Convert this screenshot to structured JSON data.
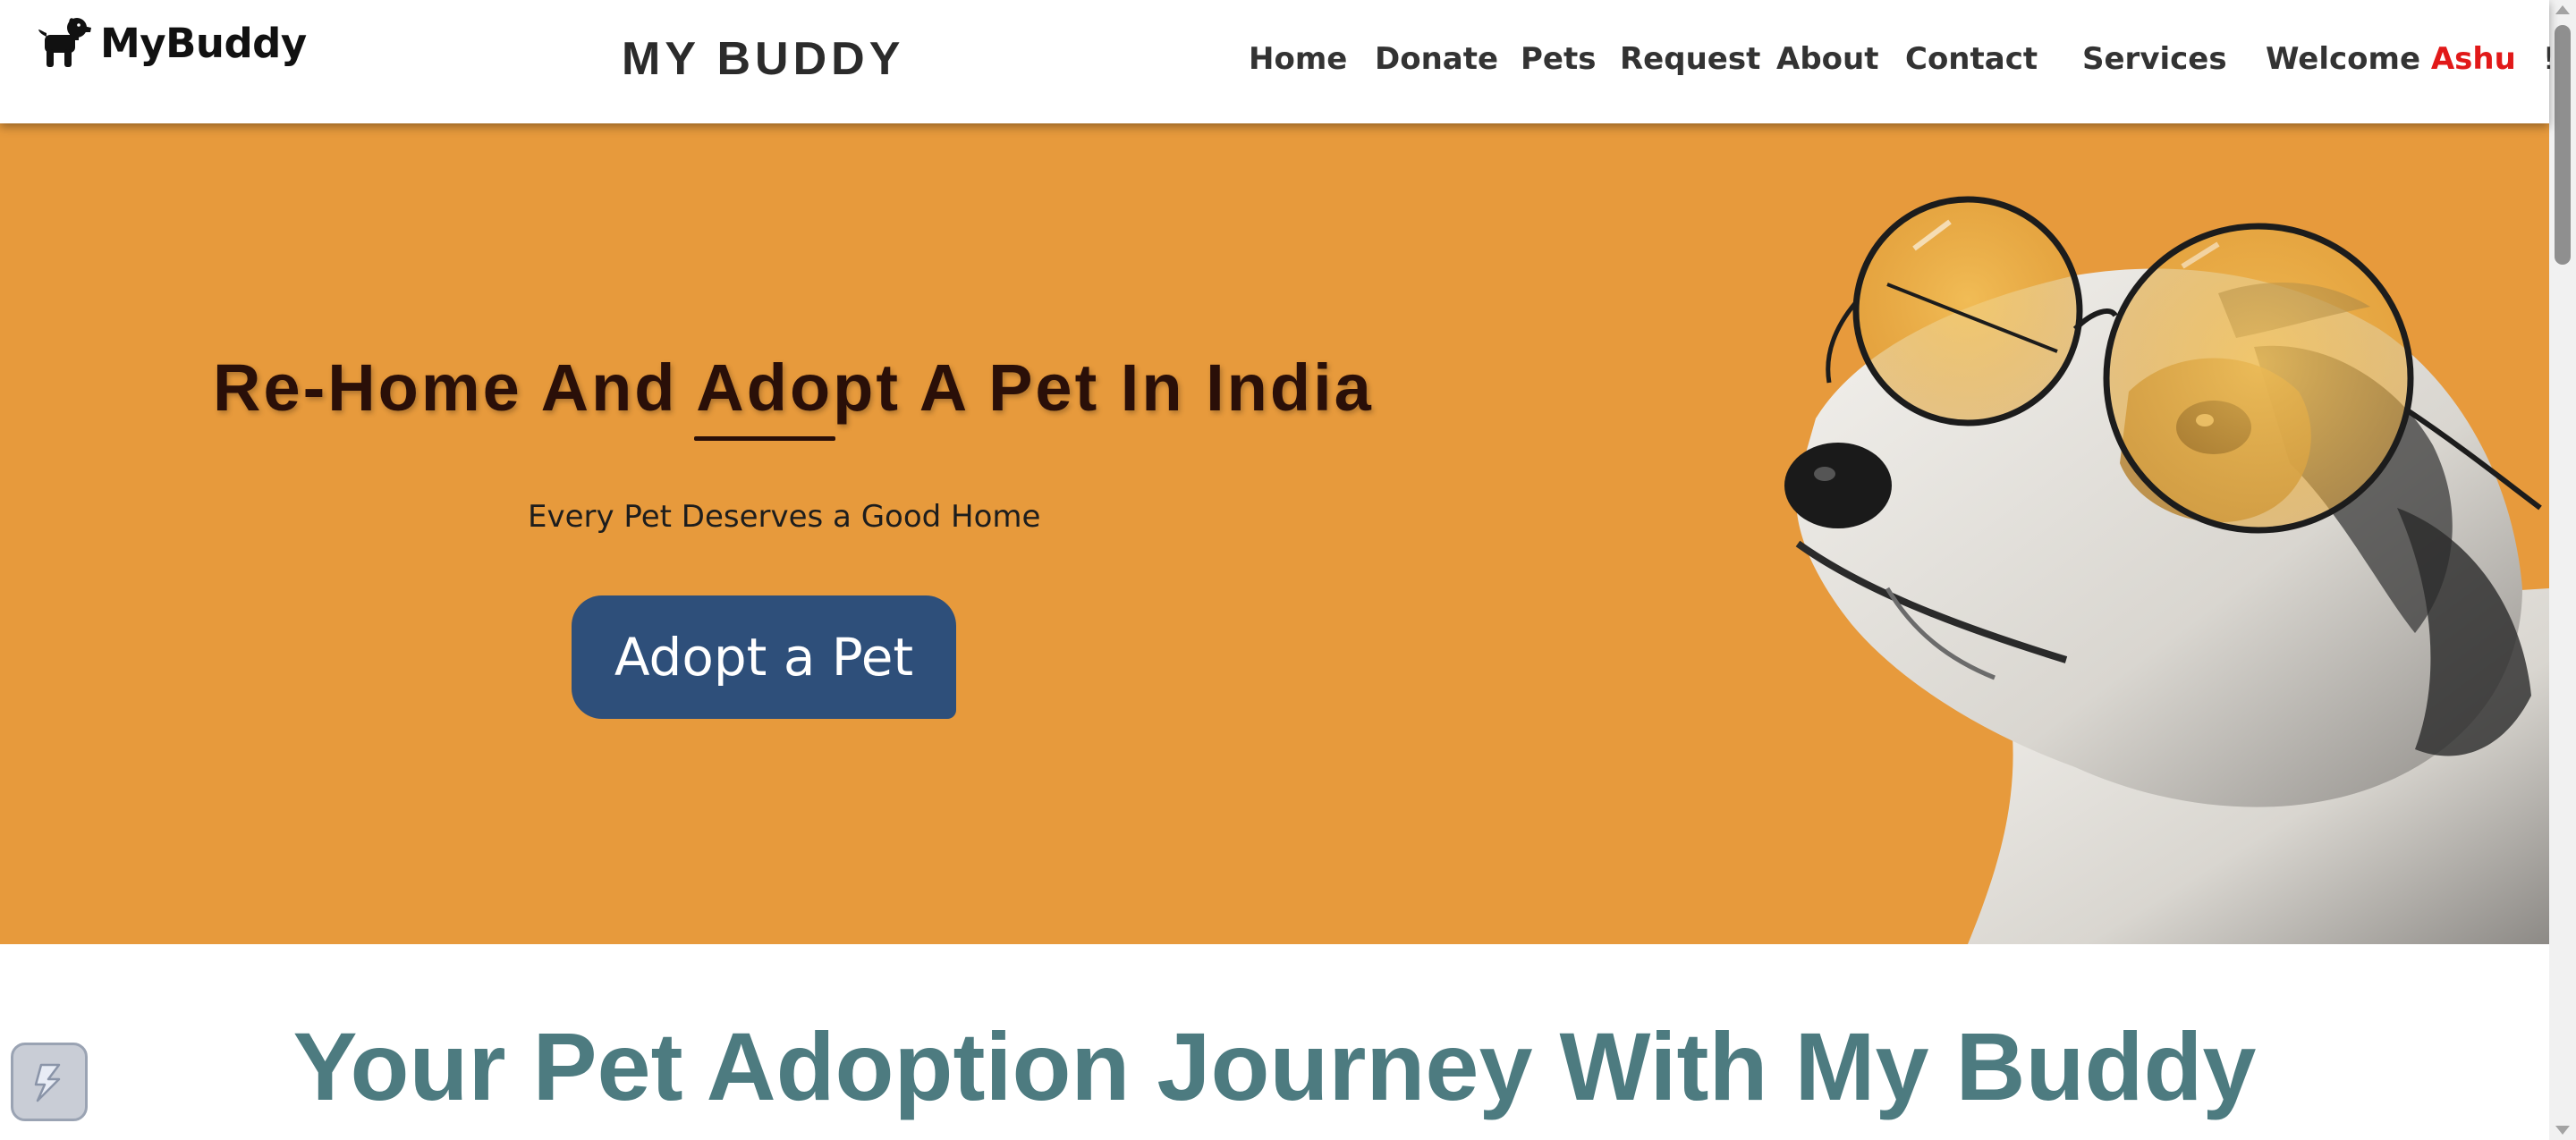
{
  "header": {
    "brand": "MyBuddy",
    "site_title": "MY BUDDY",
    "nav": [
      {
        "label": "Home"
      },
      {
        "label": "Donate"
      },
      {
        "label": "Pets"
      },
      {
        "label": "Request"
      },
      {
        "label": "About"
      },
      {
        "label": "Contact"
      },
      {
        "label": "Services"
      }
    ],
    "welcome": {
      "prefix": "Welcome",
      "user": "Ashu",
      "suffix": "!"
    }
  },
  "hero": {
    "title": "Re-Home And Adopt A Pet In India",
    "subtitle": "Every Pet Deserves a Good Home",
    "cta_label": "Adopt a Pet",
    "background_color": "#e79a3c",
    "image_icon": "dog-with-glasses"
  },
  "journey": {
    "title": "Your Pet Adoption Journey With My Buddy"
  },
  "colors": {
    "accent_user": "#e11919",
    "cta_button": "#2e4f7a",
    "journey_title": "#4d7b80",
    "hero_title": "#2a0f08"
  },
  "widget": {
    "icon": "lightning-widget-icon"
  }
}
